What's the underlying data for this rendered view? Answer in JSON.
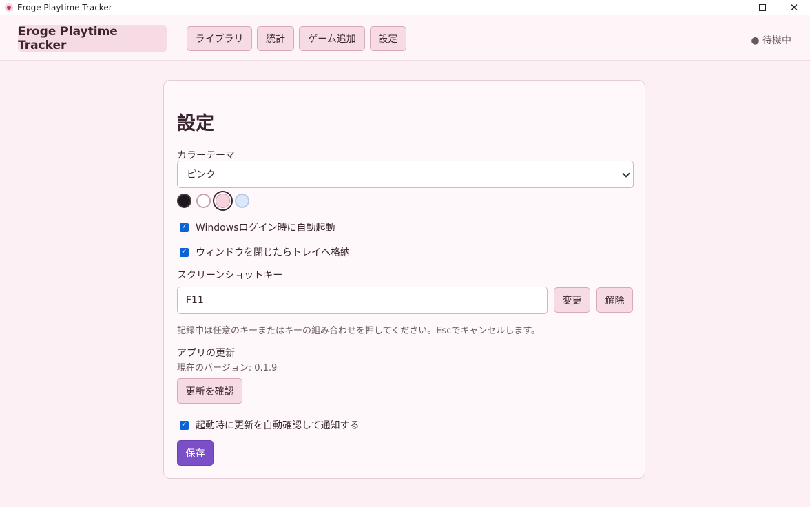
{
  "window": {
    "title": "Eroge Playtime Tracker",
    "minimize": "",
    "maximize": "",
    "close": "✕"
  },
  "header": {
    "brand": "Eroge Playtime Tracker",
    "nav": [
      "ライブラリ",
      "統計",
      "ゲーム追加",
      "設定"
    ],
    "status": "● 待機中"
  },
  "settings": {
    "title": "設定",
    "theme_label": "カラーテーマ",
    "theme_value": "ピンク",
    "theme_swatches": [
      {
        "name": "dark",
        "color": "#1c1820",
        "selected": false
      },
      {
        "name": "light",
        "color": "#ffffff",
        "selected": false
      },
      {
        "name": "pink",
        "color": "#f8d3df",
        "selected": true
      },
      {
        "name": "blue",
        "color": "#dbe8fb",
        "selected": false
      }
    ],
    "autostart_label": "Windowsログイン時に自動起動",
    "autostart_checked": true,
    "tray_label": "ウィンドウを閉じたらトレイへ格納",
    "tray_checked": true,
    "screenshot_key_label": "スクリーンショットキー",
    "screenshot_key_value": "F11",
    "change_button": "変更",
    "clear_button": "解除",
    "key_hint": "記録中は任意のキーまたはキーの組み合わせを押してください。Escでキャンセルします。",
    "update_label": "アプリの更新",
    "current_version": "現在のバージョン: 0.1.9",
    "check_update_button": "更新を確認",
    "auto_update_label": "起動時に更新を自動確認して通知する",
    "auto_update_checked": true,
    "save_button": "保存"
  }
}
